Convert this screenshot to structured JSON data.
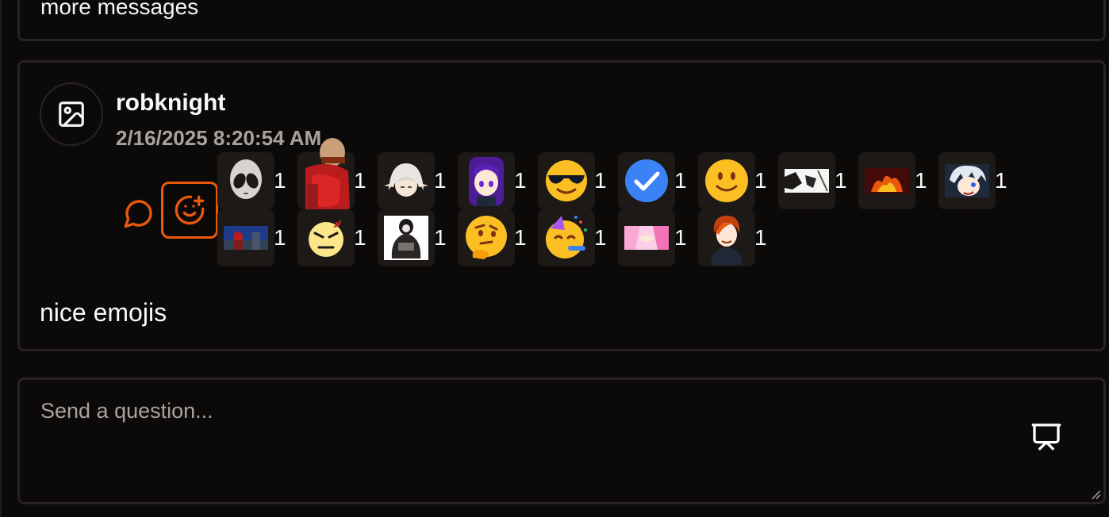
{
  "previous_card": {
    "text": "more messages"
  },
  "message": {
    "username": "robknight",
    "timestamp": "2/16/2025 8:20:54 AM",
    "text": "nice emojis",
    "reactions": [
      {
        "name": "alien-emoji",
        "count": "1"
      },
      {
        "name": "titan-custom-emoji",
        "count": "1"
      },
      {
        "name": "white-hair-elf-custom-emoji",
        "count": "1"
      },
      {
        "name": "purple-hair-girl-custom-emoji",
        "count": "1"
      },
      {
        "name": "sunglasses-emoji",
        "count": "1"
      },
      {
        "name": "blue-check-emoji",
        "count": "1"
      },
      {
        "name": "slight-smile-emoji",
        "count": "1"
      },
      {
        "name": "manga-panel-custom-emoji",
        "count": "1"
      },
      {
        "name": "fire-custom-emoji",
        "count": "1"
      },
      {
        "name": "white-hair-blindfold-custom-emoji",
        "count": "1"
      },
      {
        "name": "blue-scene-custom-emoji",
        "count": "1"
      },
      {
        "name": "angry-face-emoji",
        "count": "1"
      },
      {
        "name": "dark-figure-custom-emoji",
        "count": "1"
      },
      {
        "name": "thinking-emoji",
        "count": "1"
      },
      {
        "name": "partying-face-emoji",
        "count": "1"
      },
      {
        "name": "pink-hair-custom-emoji",
        "count": "1"
      },
      {
        "name": "orange-hair-custom-emoji",
        "count": "1"
      }
    ]
  },
  "composer": {
    "placeholder": "Send a question..."
  },
  "colors": {
    "accent": "#ea580c",
    "background": "#0c0a09",
    "muted": "#a8a29e",
    "border": "#262322"
  }
}
